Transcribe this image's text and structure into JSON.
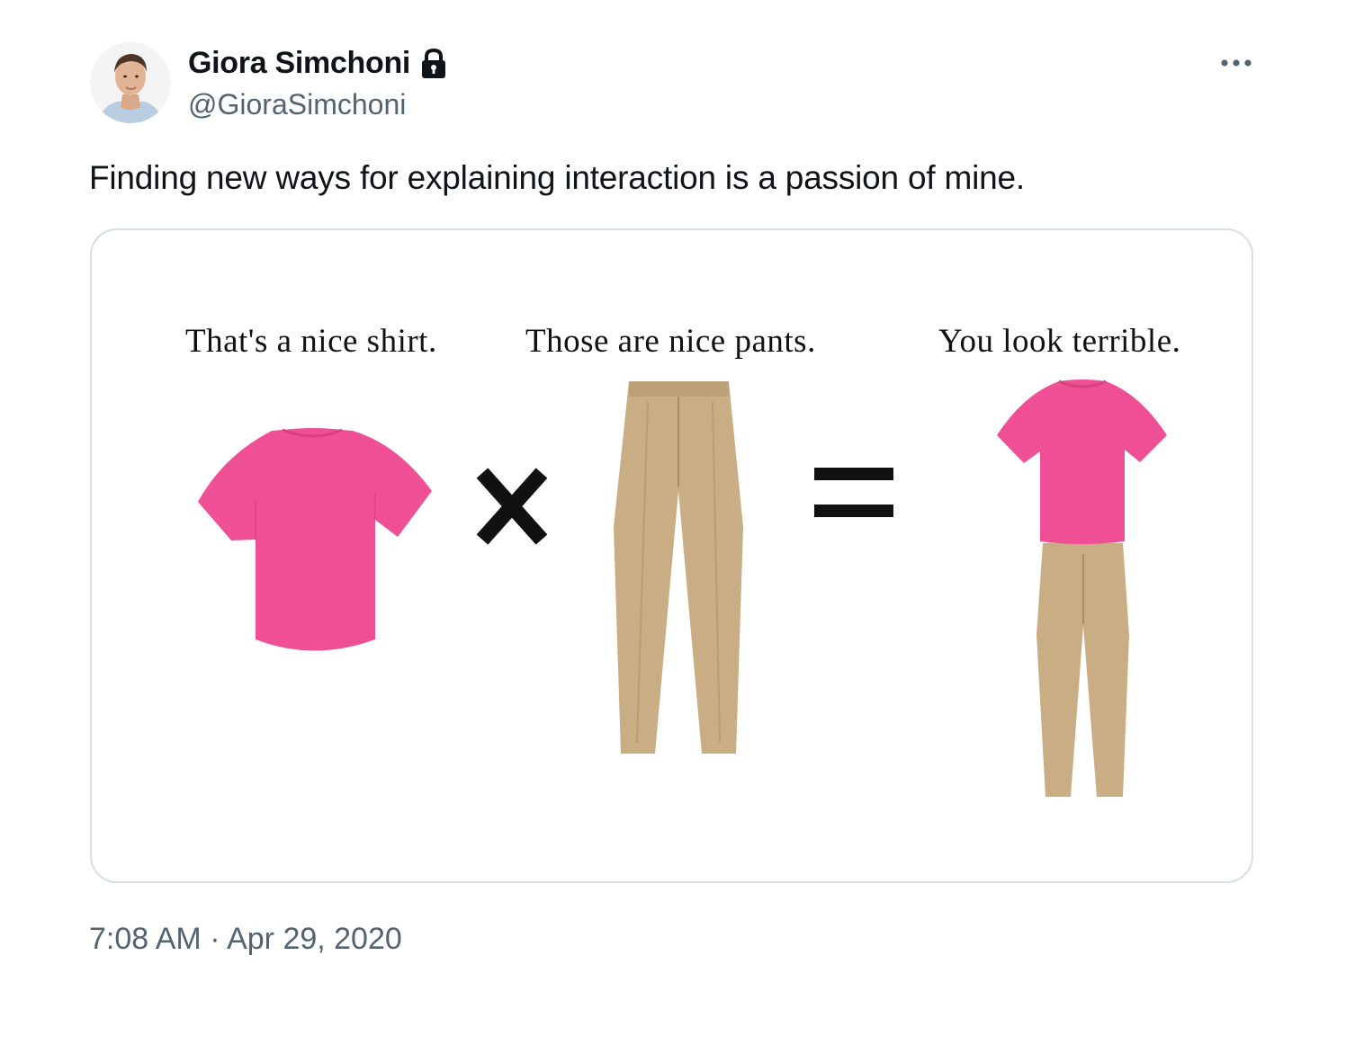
{
  "author": {
    "display_name": "Giora Simchoni",
    "handle": "@GioraSimchoni",
    "protected": true
  },
  "icons": {
    "more": "more-horizontal-icon",
    "lock": "lock-icon"
  },
  "tweet": {
    "text": "Finding new ways for explaining interaction is a passion of mine.",
    "timestamp": "7:08 AM · Apr 29, 2020"
  },
  "media": {
    "captions": {
      "shirt": "That's a nice shirt.",
      "pants": "Those are nice pants.",
      "result": "You look terrible."
    },
    "operators": {
      "times": "×",
      "equals": "="
    },
    "colors": {
      "shirt": "#ef4f95",
      "pants": "#c8ad85"
    }
  },
  "colors": {
    "text_primary": "#0f1419",
    "text_secondary": "#536471",
    "border": "#d7dee3"
  }
}
